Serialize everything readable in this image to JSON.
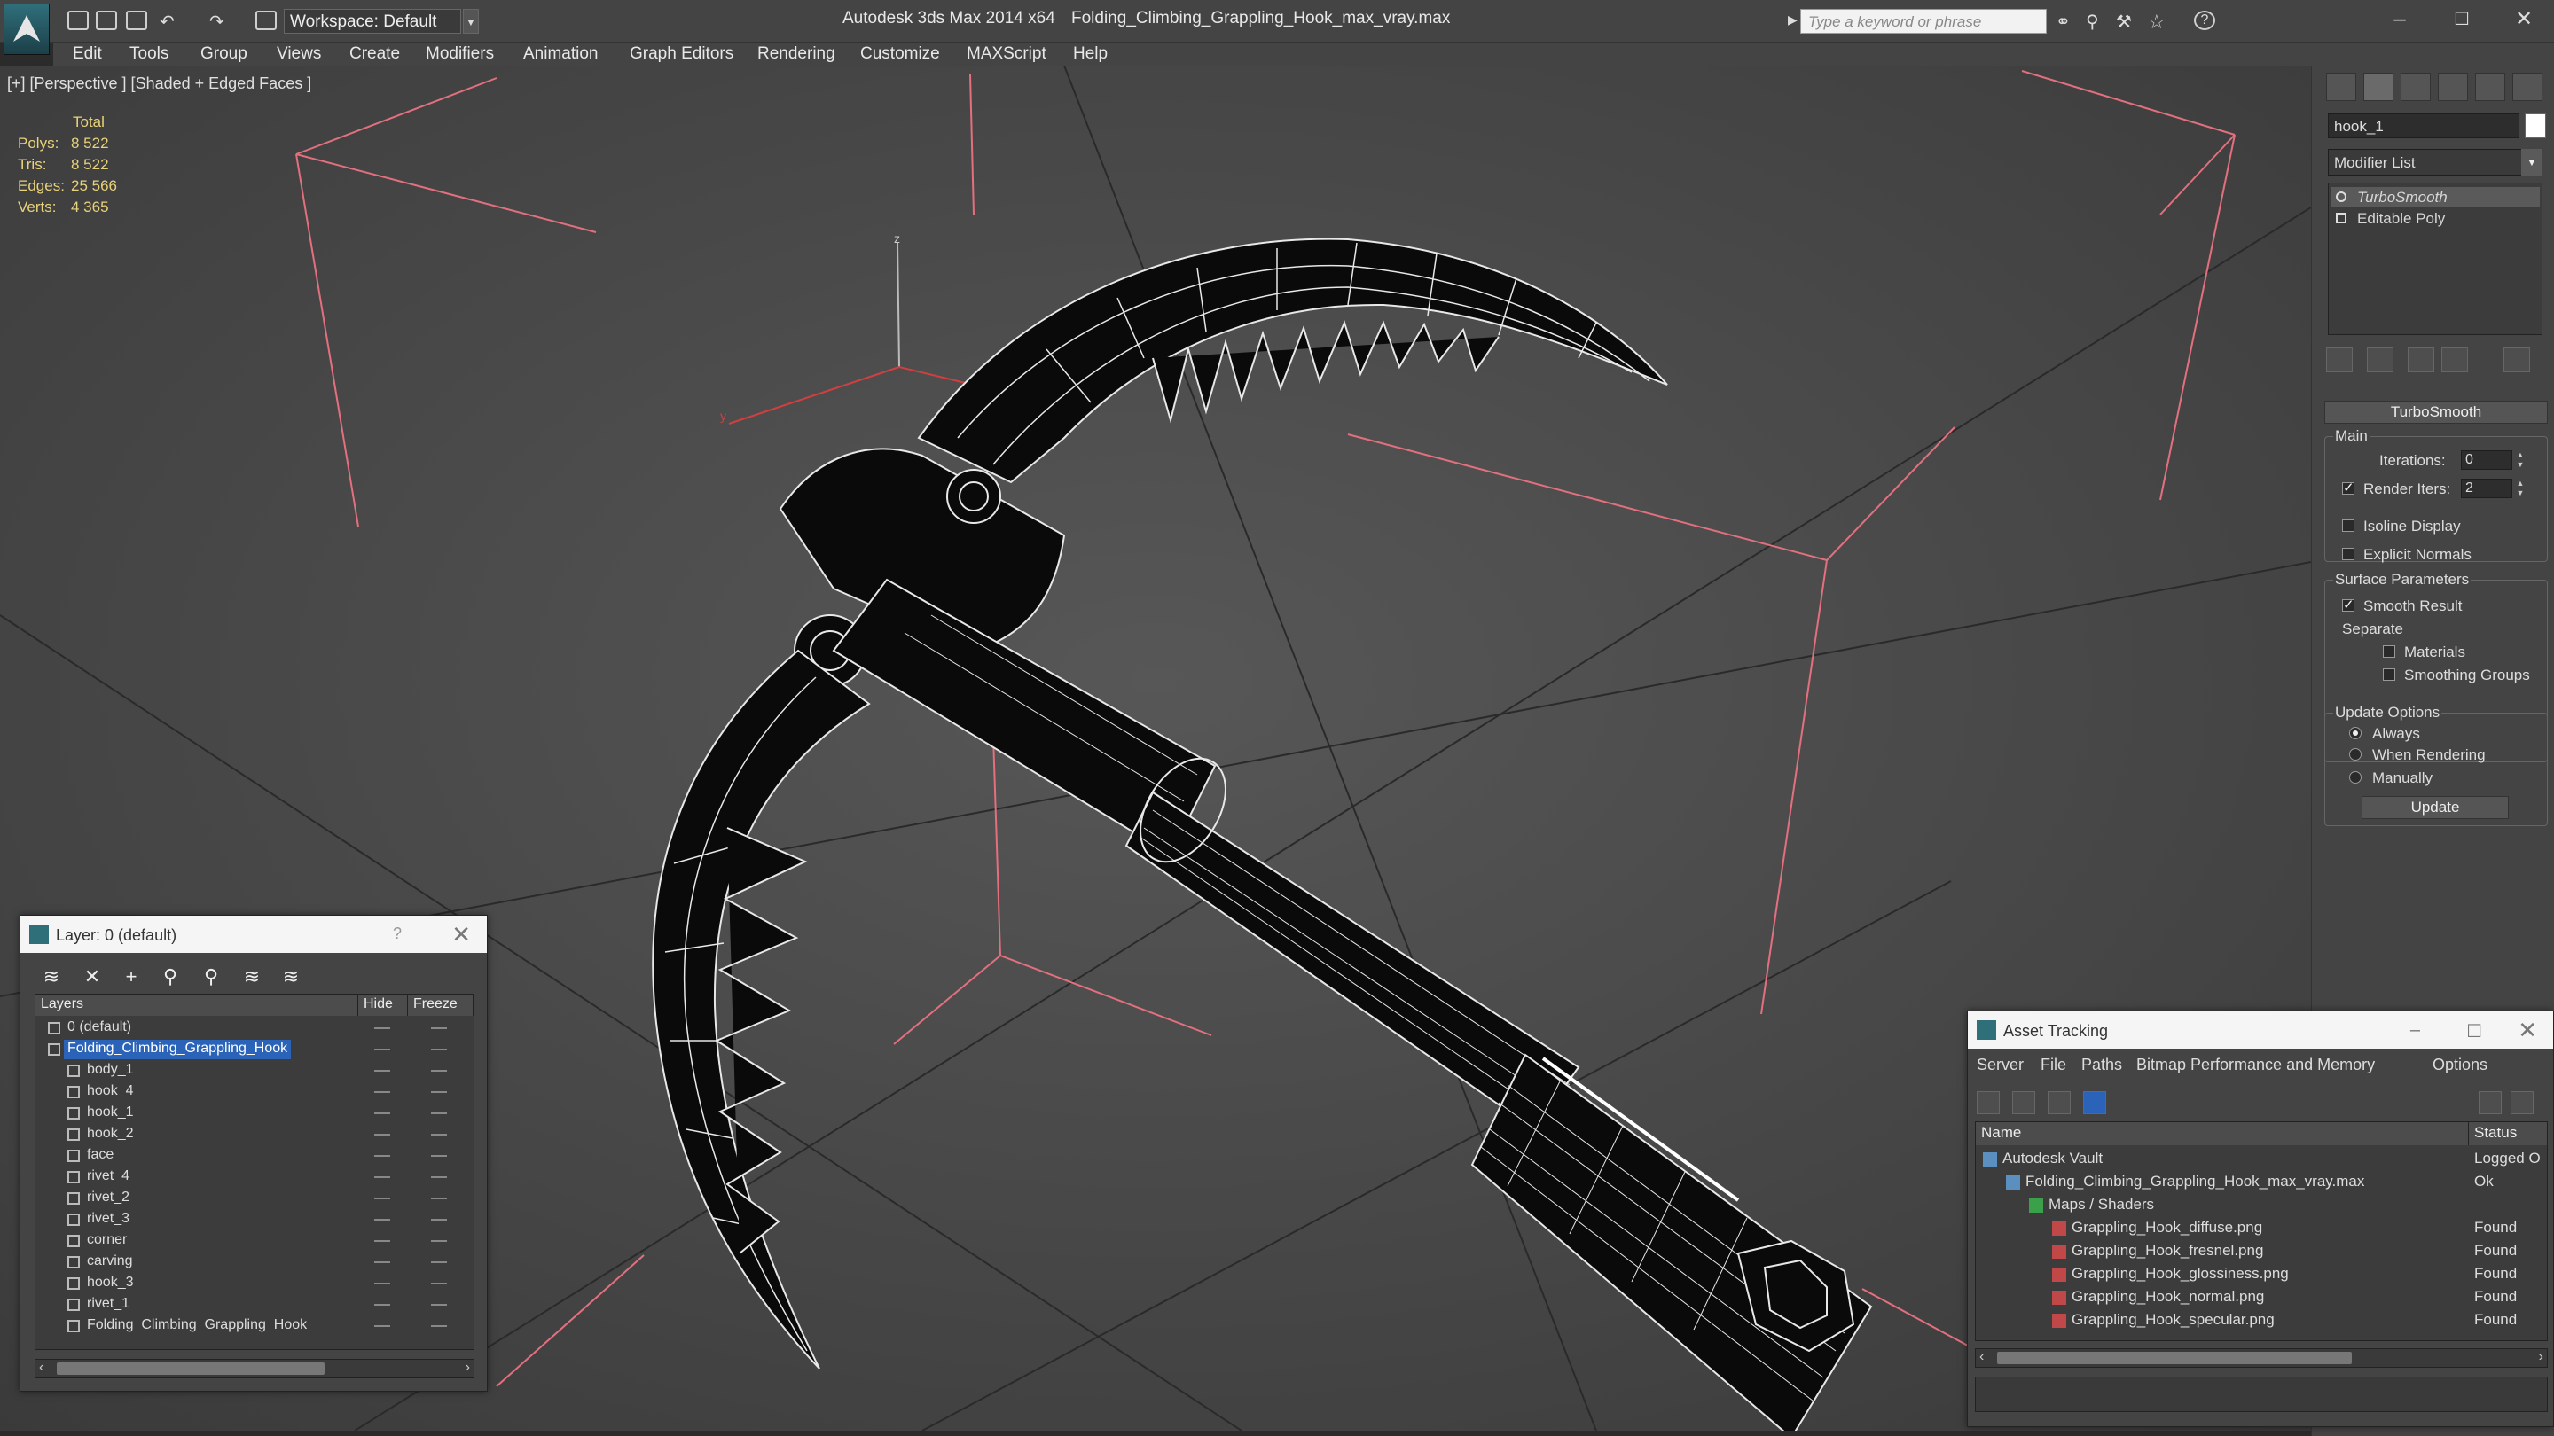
{
  "app": {
    "title": "Autodesk 3ds Max  2014 x64",
    "filename": "Folding_Climbing_Grappling_Hook_max_vray.max",
    "workspace": "Workspace: Default",
    "search_placeholder": "Type a keyword or phrase"
  },
  "menu": [
    "Edit",
    "Tools",
    "Group",
    "Views",
    "Create",
    "Modifiers",
    "Animation",
    "Graph Editors",
    "Rendering",
    "Customize",
    "MAXScript",
    "Help"
  ],
  "viewport": {
    "label": "[+] [Perspective ] [Shaded + Edged Faces ]",
    "stats": {
      "header": "Total",
      "polys_label": "Polys:",
      "polys": "8 522",
      "tris_label": "Tris:",
      "tris": "8 522",
      "edges_label": "Edges:",
      "edges": "25 566",
      "verts_label": "Verts:",
      "verts": "4 365"
    },
    "axis_x": "x",
    "axis_y": "y",
    "axis_z": "z"
  },
  "command_panel": {
    "object_name": "hook_1",
    "modifier_list": "Modifier List",
    "stack": [
      "TurboSmooth",
      "Editable Poly"
    ],
    "rollout_title": "TurboSmooth",
    "main_group": "Main",
    "iterations_label": "Iterations:",
    "iterations_value": "0",
    "render_iters_label": "Render Iters:",
    "render_iters_value": "2",
    "isoline_label": "Isoline Display",
    "explicit_normals_label": "Explicit Normals",
    "surface_group": "Surface Parameters",
    "smooth_result_label": "Smooth Result",
    "separate_label": "Separate",
    "materials_label": "Materials",
    "smoothing_groups_label": "Smoothing Groups",
    "update_group": "Update Options",
    "always_label": "Always",
    "when_rendering_label": "When Rendering",
    "manually_label": "Manually",
    "update_button": "Update"
  },
  "layer_window": {
    "title": "Layer: 0 (default)",
    "help": "?",
    "col_layers": "Layers",
    "col_hide": "Hide",
    "col_freeze": "Freeze",
    "rows": [
      {
        "name": "0 (default)",
        "level": 1
      },
      {
        "name": "Folding_Climbing_Grappling_Hook",
        "level": 1,
        "selected": true
      },
      {
        "name": "body_1",
        "level": 2
      },
      {
        "name": "hook_4",
        "level": 2
      },
      {
        "name": "hook_1",
        "level": 2
      },
      {
        "name": "hook_2",
        "level": 2
      },
      {
        "name": "face",
        "level": 2
      },
      {
        "name": "rivet_4",
        "level": 2
      },
      {
        "name": "rivet_2",
        "level": 2
      },
      {
        "name": "rivet_3",
        "level": 2
      },
      {
        "name": "corner",
        "level": 2
      },
      {
        "name": "carving",
        "level": 2
      },
      {
        "name": "hook_3",
        "level": 2
      },
      {
        "name": "rivet_1",
        "level": 2
      },
      {
        "name": "Folding_Climbing_Grappling_Hook",
        "level": 2
      }
    ]
  },
  "asset_window": {
    "title": "Asset Tracking",
    "menu": [
      "Server",
      "File",
      "Paths",
      "Bitmap Performance and Memory",
      "Options"
    ],
    "col_name": "Name",
    "col_status": "Status",
    "rows": [
      {
        "name": "Autodesk Vault",
        "status": "Logged O",
        "level": 0
      },
      {
        "name": "Folding_Climbing_Grappling_Hook_max_vray.max",
        "status": "Ok",
        "level": 1
      },
      {
        "name": "Maps / Shaders",
        "status": "",
        "level": 2
      },
      {
        "name": "Grappling_Hook_diffuse.png",
        "status": "Found",
        "level": 3
      },
      {
        "name": "Grappling_Hook_fresnel.png",
        "status": "Found",
        "level": 3
      },
      {
        "name": "Grappling_Hook_glossiness.png",
        "status": "Found",
        "level": 3
      },
      {
        "name": "Grappling_Hook_normal.png",
        "status": "Found",
        "level": 3
      },
      {
        "name": "Grappling_Hook_specular.png",
        "status": "Found",
        "level": 3
      }
    ]
  },
  "colors": {
    "ui_bg": "#444444",
    "viewport_bg": "#4a4a4a",
    "grid_pink": "#e2707e",
    "selection_blue": "#2a63b8",
    "stats_yellow": "#e8d27a"
  }
}
